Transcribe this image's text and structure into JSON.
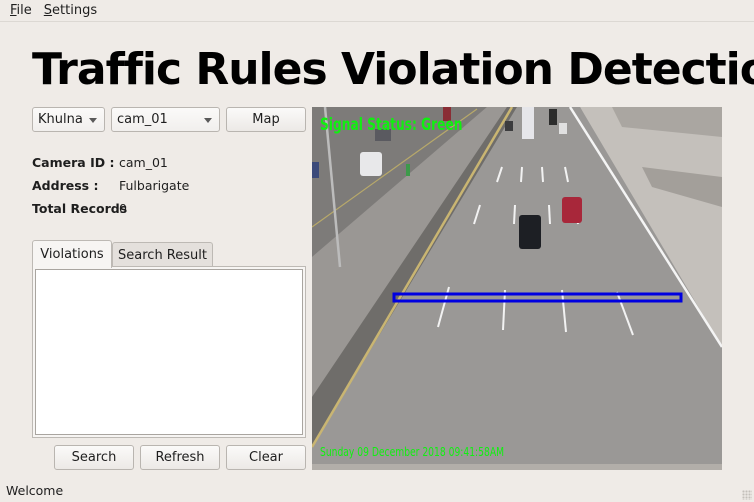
{
  "menu": {
    "items": [
      {
        "label": "File",
        "mnemonic": "F",
        "rest": "ile"
      },
      {
        "label": "Settings",
        "mnemonic": "S",
        "rest": "ettings"
      }
    ]
  },
  "header": {
    "title": "Traffic Rules Violation Detection"
  },
  "controls": {
    "city_select": {
      "value": "Khulna"
    },
    "camera_select": {
      "value": "cam_01"
    },
    "map_button": "Map"
  },
  "camera_info": {
    "camera_id_label": "Camera ID :",
    "camera_id_value": "cam_01",
    "address_label": "Address :",
    "address_value": "Fulbarigate",
    "total_records_label": "Total Records",
    "total_records_value": "0"
  },
  "tabs": [
    {
      "label": "Violations",
      "active": true
    },
    {
      "label": "Search Result",
      "active": false
    }
  ],
  "violations_list": [],
  "actions": {
    "search": "Search",
    "refresh": "Refresh",
    "clear": "Clear"
  },
  "video": {
    "signal_status": "Signal Status: Green",
    "timestamp": "Sunday 09 December 2018 09:41:58AM",
    "overlay_color": "#10f010",
    "detection_line_color": "#0000e0"
  },
  "status": {
    "message": "Welcome"
  }
}
